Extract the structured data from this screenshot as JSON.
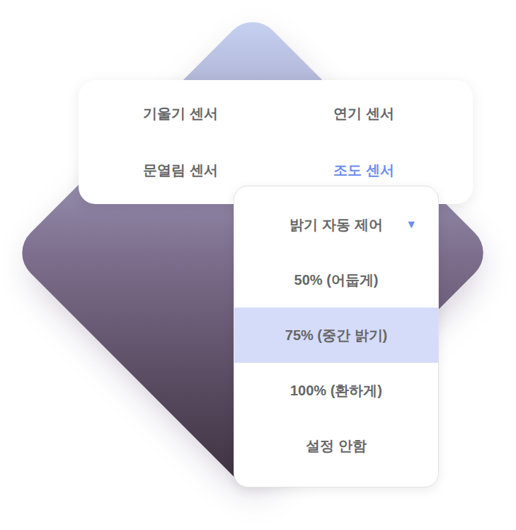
{
  "sensors": [
    {
      "label": "기울기 센서",
      "selected": false
    },
    {
      "label": "연기 센서",
      "selected": false
    },
    {
      "label": "문열림 센서",
      "selected": false
    },
    {
      "label": "조도 센서",
      "selected": true
    }
  ],
  "dropdown": {
    "label": "밝기 자동 제어",
    "arrow": "▼",
    "options": [
      {
        "label": "50% (어둡게)",
        "selected": false
      },
      {
        "label": "75% (중간 밝기)",
        "selected": true
      },
      {
        "label": "100% (환하게)",
        "selected": false
      },
      {
        "label": "설정 안함",
        "selected": false
      }
    ]
  }
}
